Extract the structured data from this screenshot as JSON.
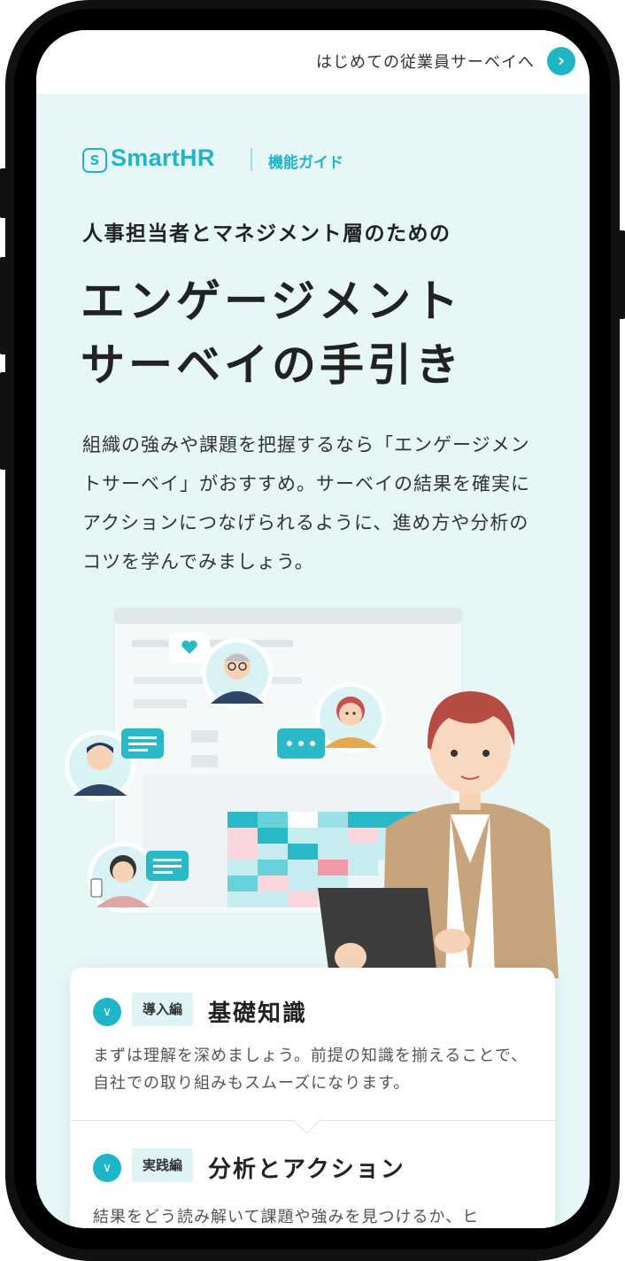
{
  "topbar": {
    "link_label": "はじめての従業員サーベイへ",
    "arrow_icon": "chevron-right-icon"
  },
  "brand": {
    "logo_text": "SmartHR",
    "logo_icon": "smarthr-s-icon",
    "guide_label": "機能ガイド"
  },
  "hero": {
    "kicker": "人事担当者とマネジメント層のための",
    "title_line1": "エンゲージメント",
    "title_line2": "サーベイの手引き",
    "lead": "組織の強みや課題を把握するなら「エンゲージメントサーベイ」がおすすめ。サーベイの結果を確実にアクションにつなげられるように、進め方や分析のコツを学んでみましょう。"
  },
  "sections": [
    {
      "tag": "導入編",
      "title": "基礎知識",
      "description": "まずは理解を深めましょう。前提の知識を揃えることで、自社での取り組みもスムーズになります。"
    },
    {
      "tag": "実践編",
      "title": "分析とアクション",
      "description": "結果をどう読み解いて課題や強みを見つけるか、ヒ"
    }
  ],
  "colors": {
    "accent": "#1fb5c6",
    "background": "#e7f7f8",
    "tag_bg": "#dff4f6",
    "text": "#222222"
  }
}
